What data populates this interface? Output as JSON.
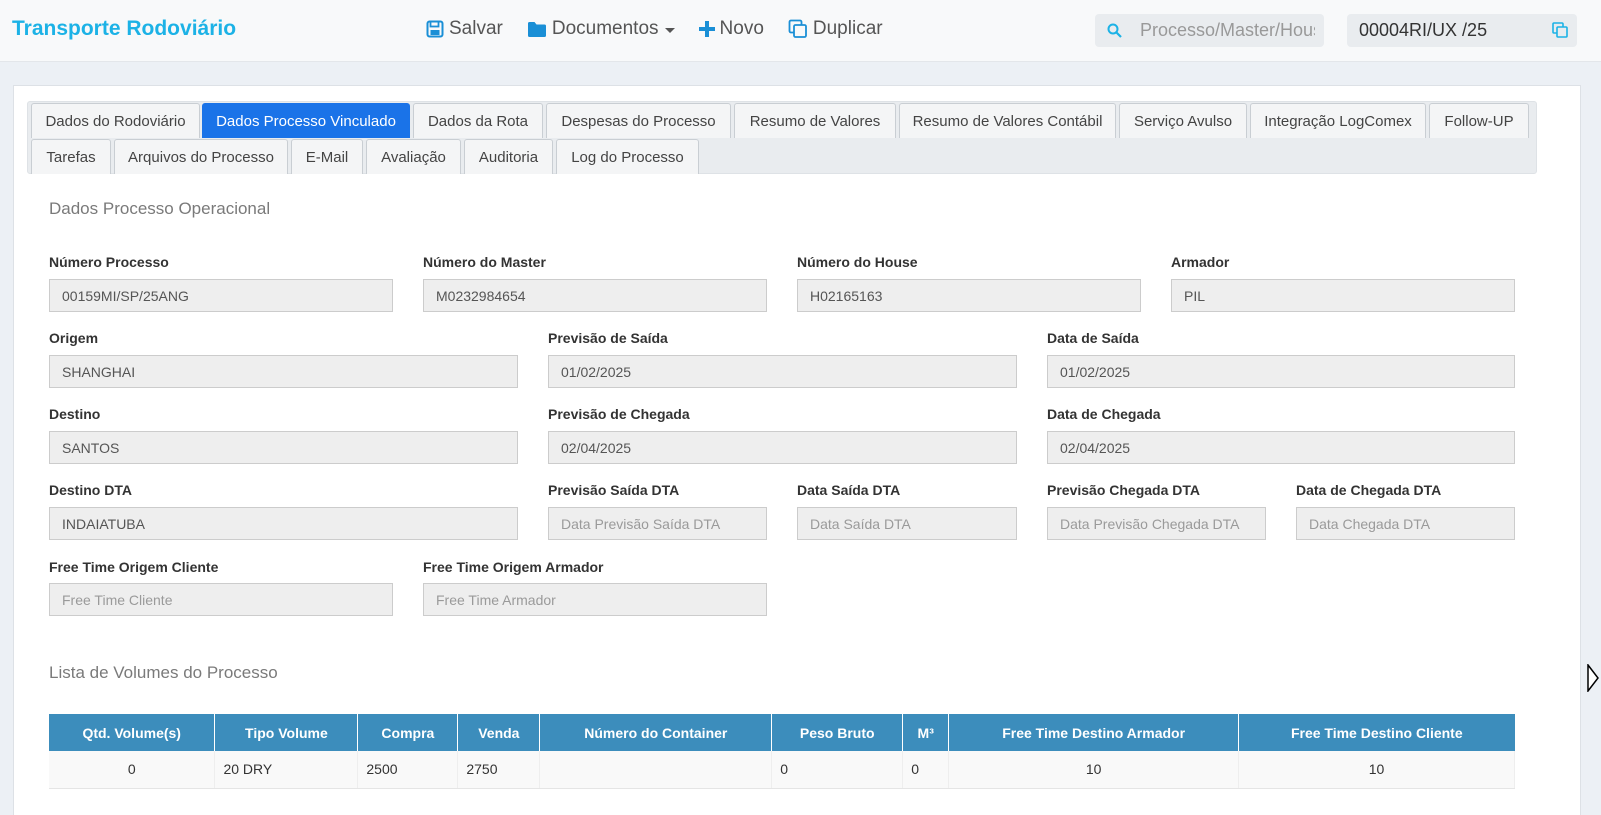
{
  "app": {
    "title": "Transporte Rodoviário"
  },
  "toolbar": {
    "save_label": "Salvar",
    "documents_label": "Documentos",
    "new_label": "Novo",
    "duplicate_label": "Duplicar"
  },
  "search": {
    "placeholder": "Processo/Master/House"
  },
  "current_process": {
    "value": "00004RI/UX /25"
  },
  "tabs": [
    "Dados do Rodoviário",
    "Dados Processo Vinculado",
    "Dados da Rota",
    "Despesas do Processo",
    "Resumo de Valores",
    "Resumo de Valores Contábil",
    "Serviço Avulso",
    "Integração LogComex",
    "Follow-UP",
    "Tarefas",
    "Arquivos do Processo",
    "E-Mail",
    "Avaliação",
    "Auditoria",
    "Log do Processo"
  ],
  "active_tab": "Dados Processo Vinculado",
  "section_operational": {
    "title": "Dados Processo Operacional"
  },
  "fields": {
    "numero_processo": {
      "label": "Número Processo",
      "value": "00159MI/SP/25ANG"
    },
    "numero_master": {
      "label": "Número do Master",
      "value": "M0232984654"
    },
    "numero_house": {
      "label": "Número do House",
      "value": "H02165163"
    },
    "armador": {
      "label": "Armador",
      "value": "PIL"
    },
    "origem": {
      "label": "Origem",
      "value": "SHANGHAI"
    },
    "previsao_saida": {
      "label": "Previsão de Saída",
      "value": "01/02/2025"
    },
    "data_saida": {
      "label": "Data de Saída",
      "value": "01/02/2025"
    },
    "destino": {
      "label": "Destino",
      "value": "SANTOS"
    },
    "previsao_chegada": {
      "label": "Previsão de Chegada",
      "value": "02/04/2025"
    },
    "data_chegada": {
      "label": "Data de Chegada",
      "value": "02/04/2025"
    },
    "destino_dta": {
      "label": "Destino DTA",
      "value": "INDAIATUBA"
    },
    "previsao_saida_dta": {
      "label": "Previsão Saída DTA",
      "placeholder": "Data Previsão Saída DTA"
    },
    "data_saida_dta": {
      "label": "Data Saída DTA",
      "placeholder": "Data Saída DTA"
    },
    "previsao_chegada_dta": {
      "label": "Previsão Chegada DTA",
      "placeholder": "Data Previsão Chegada DTA"
    },
    "data_chegada_dta": {
      "label": "Data de Chegada DTA",
      "placeholder": "Data Chegada DTA"
    },
    "free_time_origem_cliente": {
      "label": "Free Time Origem Cliente",
      "placeholder": "Free Time Cliente"
    },
    "free_time_origem_armador": {
      "label": "Free Time Origem Armador",
      "placeholder": "Free Time Armador"
    }
  },
  "section_volumes": {
    "title": "Lista de Volumes do Processo"
  },
  "volumes_table": {
    "headers": [
      "Qtd. Volume(s)",
      "Tipo Volume",
      "Compra",
      "Venda",
      "Número do Container",
      "Peso Bruto",
      "M³",
      "Free Time Destino Armador",
      "Free Time Destino Cliente"
    ],
    "rows": [
      [
        "0",
        "20 DRY",
        "2500",
        "2750",
        "",
        "0",
        "0",
        "10",
        "10"
      ]
    ]
  },
  "colors": {
    "brand": "#1cb2e6",
    "active_tab": "#1a73e8",
    "table_header": "#3c8dbc"
  }
}
